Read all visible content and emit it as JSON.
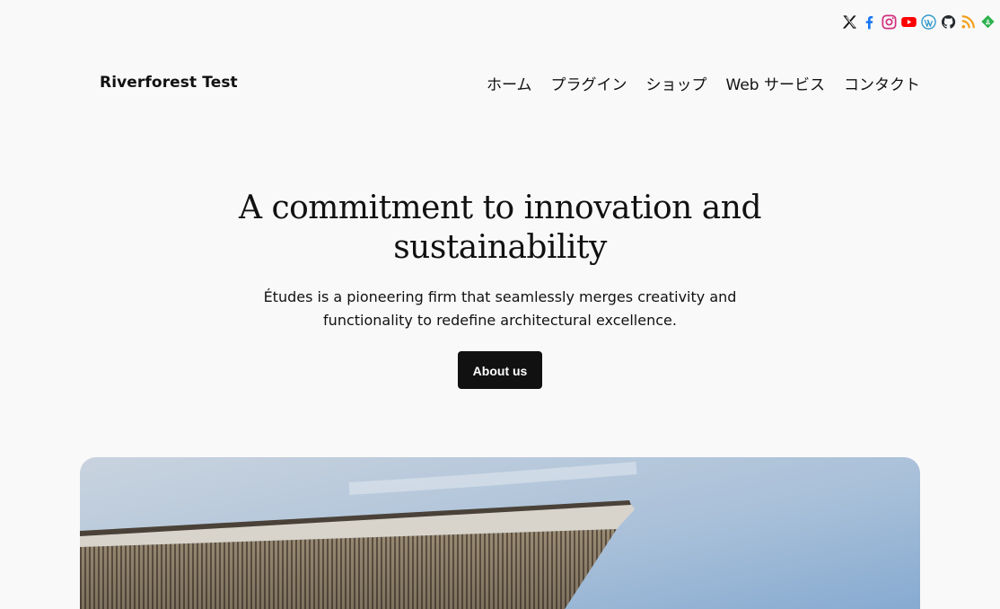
{
  "social": {
    "items": [
      {
        "name": "x",
        "color": "#111111"
      },
      {
        "name": "facebook",
        "color": "#1877f2"
      },
      {
        "name": "instagram",
        "color": "#d3307f"
      },
      {
        "name": "youtube",
        "color": "#ff0000"
      },
      {
        "name": "wordpress",
        "color": "#3499cd"
      },
      {
        "name": "github",
        "color": "#24292e"
      },
      {
        "name": "rss",
        "color": "#f39c12"
      },
      {
        "name": "feedly",
        "color": "#2bb24c"
      }
    ]
  },
  "header": {
    "site_title": "Riverforest Test",
    "nav": [
      "ホーム",
      "プラグイン",
      "ショップ",
      "Web サービス",
      "コンタクト"
    ]
  },
  "hero": {
    "heading": "A commitment to innovation and sustainability",
    "text": "Études is a pioneering firm that seamlessly merges creativity and functionality to redefine architectural excellence.",
    "button_label": "About us"
  },
  "image": {
    "subject": "building-canopy-photo",
    "sky_color": "#8fb1d6",
    "canopy_color": "#8a7b66"
  }
}
